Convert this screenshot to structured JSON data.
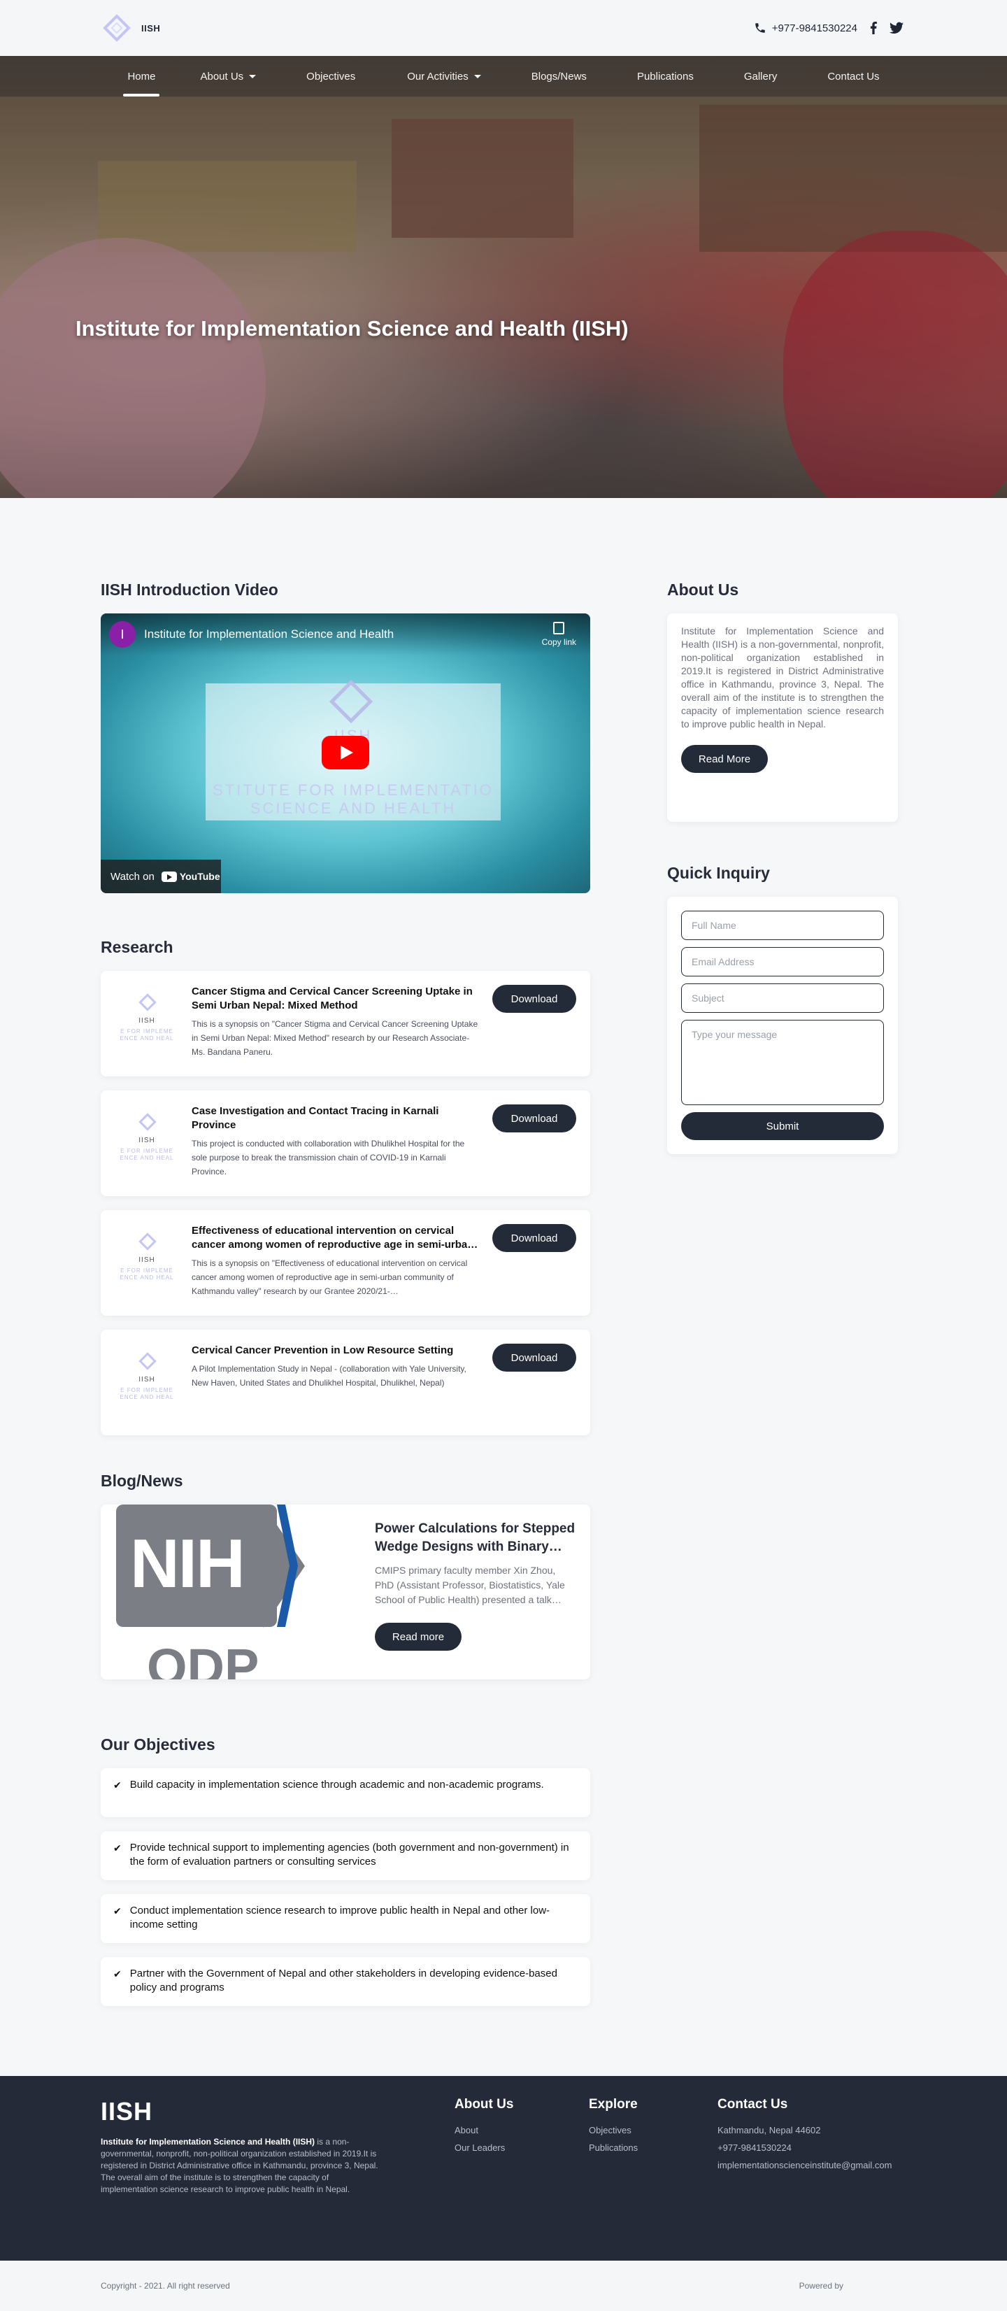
{
  "brand": {
    "name": "IISH",
    "phone": "+977-9841530224"
  },
  "nav": {
    "items": [
      {
        "label": "Home",
        "active": true,
        "dropdown": false
      },
      {
        "label": "About Us",
        "active": false,
        "dropdown": true
      },
      {
        "label": "Objectives",
        "active": false,
        "dropdown": false
      },
      {
        "label": "Our Activities",
        "active": false,
        "dropdown": true
      },
      {
        "label": "Blogs/News",
        "active": false,
        "dropdown": false
      },
      {
        "label": "Publications",
        "active": false,
        "dropdown": false
      },
      {
        "label": "Gallery",
        "active": false,
        "dropdown": false
      },
      {
        "label": "Contact Us",
        "active": false,
        "dropdown": false
      }
    ]
  },
  "hero": {
    "title": "Institute for Implementation Science and Health (IISH)",
    "slides": 3,
    "active_slide": 2
  },
  "video": {
    "heading": "IISH Introduction Video",
    "channel_initial": "I",
    "title": "Institute for Implementation Science and Health",
    "copy_link": "Copy link",
    "card_logo": "IISH",
    "card_text": "STITUTE FOR IMPLEMENTATIO\nSCIENCE AND HEALTH",
    "watch_on": "Watch on",
    "youtube": "YouTube"
  },
  "research": {
    "heading": "Research",
    "thumb_logo": "IISH",
    "thumb_text": "E FOR IMPLEME\nENCE AND HEAL",
    "download_label": "Download",
    "items": [
      {
        "title": "Cancer Stigma and Cervical Cancer Screening Uptake in Semi Urban Nepal: Mixed Method",
        "desc": "This is a synopsis on \"Cancer Stigma and Cervical Cancer Screening Uptake in Semi Urban Nepal: Mixed Method\" research by our Research Associate-Ms. Bandana Paneru."
      },
      {
        "title": "Case Investigation and Contact Tracing in Karnali Province",
        "desc": "This project is conducted with collaboration with Dhulikhel Hospital for the sole purpose to break the transmission chain of COVID-19 in Karnali Province."
      },
      {
        "title": "Effectiveness of educational intervention on cervical cancer among women of reproductive age in semi-urba…",
        "desc": "This is a synopsis on \"Effectiveness of educational intervention on cervical cancer among women of reproductive age in semi-urban community of Kathmandu valley\" research by our Grantee 2020/21-…"
      },
      {
        "title": "Cervical Cancer Prevention in Low Resource Setting",
        "desc": "A Pilot Implementation Study in Nepal - (collaboration with Yale University, New Haven, United States and Dhulikhel Hospital, Dhulikhel, Nepal)"
      }
    ]
  },
  "blog": {
    "heading": "Blog/News",
    "img_text_1": "NIH",
    "img_text_2": "ODP",
    "title": "Power Calculations for Stepped Wedge Designs with Binary…",
    "desc": "CMIPS primary faculty member Xin Zhou, PhD (Assistant Professor, Biostatistics, Yale School of Public Health) presented a talk…",
    "read_more": "Read more"
  },
  "objectives": {
    "heading": "Our Objectives",
    "check": "✔",
    "items": [
      "Build capacity in implementation science through academic and non-academic programs.",
      "Provide technical support to implementing agencies (both government and non-government) in the form of evaluation partners or consulting services",
      "Conduct implementation science research to improve public health in Nepal and other low-income setting",
      "Partner with the Government of Nepal and other stakeholders in developing evidence-based policy and programs"
    ]
  },
  "about": {
    "heading": "About Us",
    "text": "Institute for Implementation Science and Health (IISH) is a non-governmental, nonprofit, non-political organization established in 2019.It is registered in District Administrative office in Kathmandu, province 3, Nepal. The overall aim of the institute is to strengthen the capacity of implementation science research to improve public health in Nepal.",
    "read_more": "Read More"
  },
  "inquiry": {
    "heading": "Quick Inquiry",
    "full_name_placeholder": "Full Name",
    "email_placeholder": "Email Address",
    "subject_placeholder": "Subject",
    "message_placeholder": "Type your message",
    "submit_label": "Submit"
  },
  "footer": {
    "brand": "IISH",
    "about_bold": "Institute for Implementation Science and Health (IISH)",
    "about_rest": " is a non-governmental, nonprofit, non-political organization established in 2019.It is registered in District Administrative office in Kathmandu, province 3, Nepal. The overall aim of the institute is to strengthen the capacity of implementation science research to improve public health in Nepal.",
    "about_heading": "About Us",
    "about_links": [
      "About",
      "Our Leaders"
    ],
    "explore_heading": "Explore",
    "explore_links": [
      "Objectives",
      "Publications"
    ],
    "contact_heading": "Contact Us",
    "contact_lines": [
      "Kathmandu, Nepal 44602",
      "+977-9841530224",
      "implementationscienceinstitute@gmail.com"
    ],
    "copyright": "Copyright - 2021. All right reserved",
    "powered_by": "Powered by"
  }
}
